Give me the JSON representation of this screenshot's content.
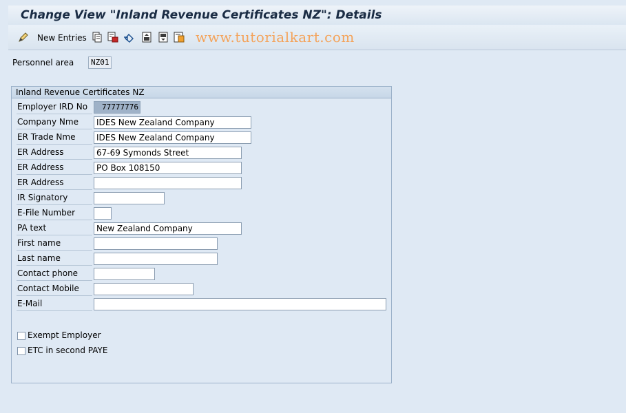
{
  "window": {
    "title": "Change View \"Inland Revenue Certificates NZ\": Details"
  },
  "toolbar": {
    "new_entries_label": "New Entries",
    "watermark": "www.tutorialkart.com",
    "icons": [
      "pen-icon",
      "copy-icon",
      "delete-icon",
      "undo-icon",
      "prev-icon",
      "next-icon",
      "variant-icon"
    ]
  },
  "header_fields": {
    "personnel_area_label": "Personnel area",
    "personnel_area_value": "NZ01"
  },
  "group": {
    "title": "Inland Revenue Certificates NZ",
    "rows": [
      {
        "label": "Employer IRD No",
        "value": "77777776"
      },
      {
        "label": "Company Nme",
        "value": "IDES New Zealand Company"
      },
      {
        "label": "ER Trade Nme",
        "value": "IDES New Zealand Company"
      },
      {
        "label": "ER Address",
        "value": "67-69 Symonds Street"
      },
      {
        "label": "ER Address",
        "value": "PO Box 108150"
      },
      {
        "label": "ER Address",
        "value": ""
      },
      {
        "label": "IR Signatory",
        "value": ""
      },
      {
        "label": "E-File Number",
        "value": ""
      },
      {
        "label": "PA text",
        "value": "New Zealand Company"
      },
      {
        "label": "First name",
        "value": ""
      },
      {
        "label": "Last name",
        "value": ""
      },
      {
        "label": "Contact phone",
        "value": ""
      },
      {
        "label": "Contact Mobile",
        "value": ""
      },
      {
        "label": "E-Mail",
        "value": ""
      }
    ],
    "checkboxes": [
      {
        "label": "Exempt Employer",
        "checked": false
      },
      {
        "label": "ETC in second PAYE",
        "checked": false
      }
    ]
  }
}
